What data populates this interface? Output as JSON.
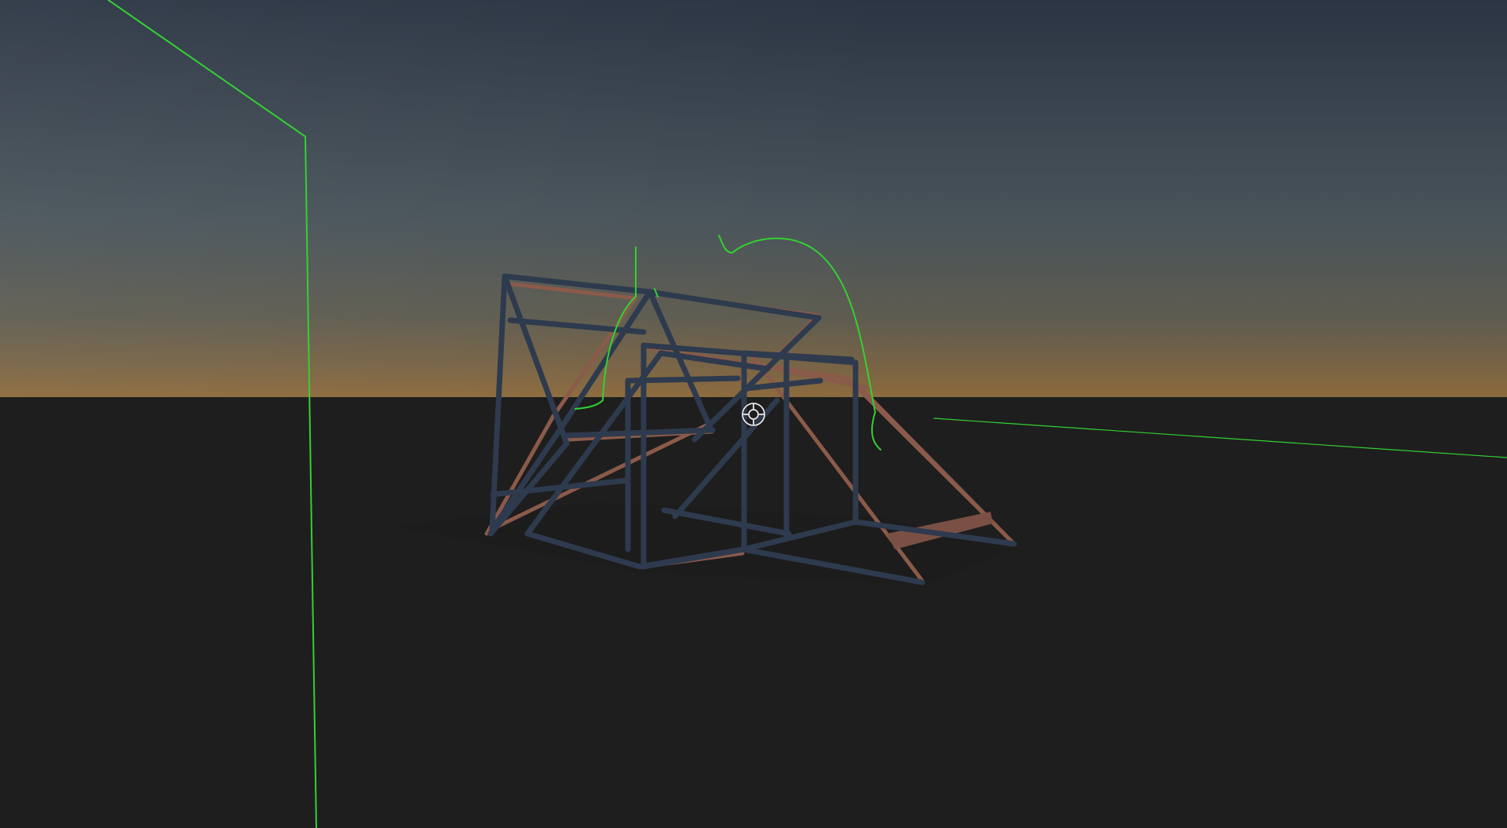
{
  "scene": {
    "type": "3d-viewport",
    "subject": "wireframe-structure",
    "colors": {
      "sky_top": "#2b3543",
      "sky_mid": "#48525a",
      "horizon_glow": "#8a6a40",
      "ground": "#1e1e1e",
      "frame_dark": "#2e3a4e",
      "frame_edge": "#8a5a4a",
      "debug_line": "#32d232",
      "crosshair": "#e6e6e6"
    },
    "icons": {
      "crosshair": "crosshair-reticle-icon"
    }
  }
}
